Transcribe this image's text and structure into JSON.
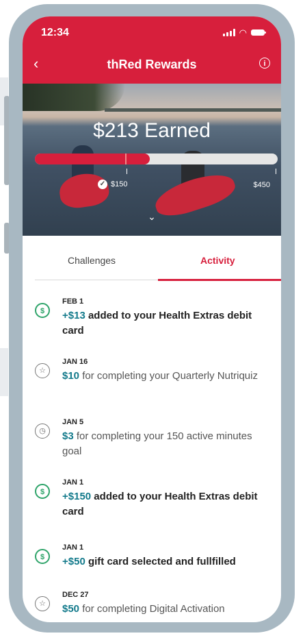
{
  "status": {
    "time": "12:34"
  },
  "header": {
    "title": "thRed Rewards"
  },
  "hero": {
    "earned": "$213 Earned",
    "progress_current": 213,
    "progress_max": 450,
    "milestone_1": "$150",
    "milestone_2": "$450"
  },
  "tabs": [
    {
      "label": "Challenges"
    },
    {
      "label": "Activity"
    }
  ],
  "activity": [
    {
      "icon": "dollar-refresh-icon",
      "date": "FEB 1",
      "amount": "+$13",
      "text": " added to your Health Extras debit card"
    },
    {
      "icon": "star-icon",
      "date": "JAN 16",
      "amount": "$10",
      "text": " for completing your Quarterly Nutriquiz"
    },
    {
      "icon": "stopwatch-icon",
      "date": "JAN 5",
      "amount": "$3",
      "text": " for completing your 150 active minutes goal"
    },
    {
      "icon": "dollar-refresh-icon",
      "date": "JAN 1",
      "amount": "+$150",
      "text": " added to your Health Extras debit card"
    },
    {
      "icon": "dollar-refresh-icon",
      "date": "JAN 1",
      "amount": "+$50",
      "text": " gift card selected and fullfilled"
    },
    {
      "icon": "star-icon",
      "date": "DEC 27",
      "amount": "$50",
      "text": " for completing Digital Activation"
    }
  ],
  "colors": {
    "brand": "#d71f3c",
    "amount": "#137a8b",
    "success": "#2fa46a"
  }
}
